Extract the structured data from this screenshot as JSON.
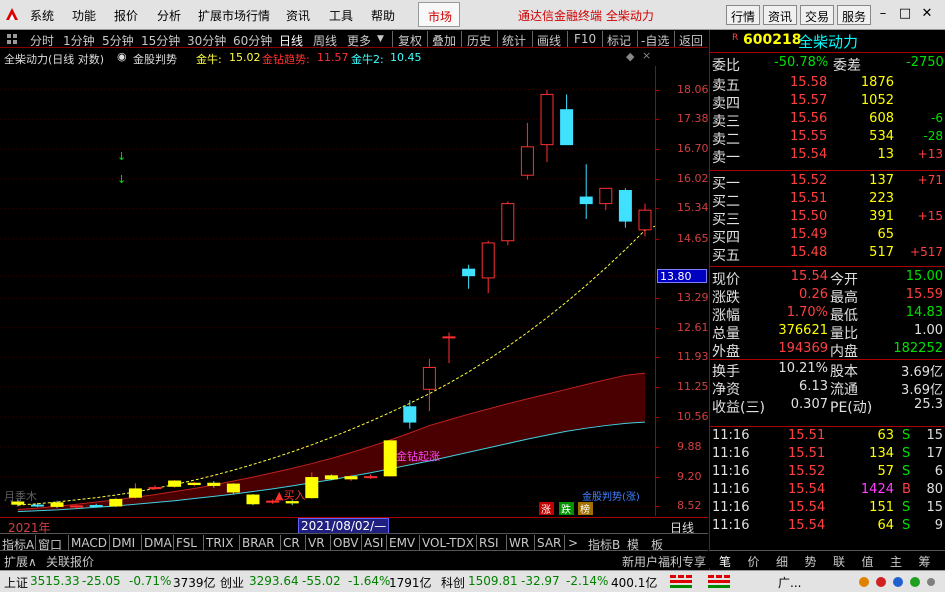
{
  "menu": {
    "items": [
      "系统",
      "功能",
      "报价",
      "分析",
      "扩展市场行情",
      "资讯",
      "工具",
      "帮助"
    ],
    "market": "市场",
    "title": "通达信金融终端 全柴动力",
    "right_buttons": [
      "行情",
      "资讯",
      "交易",
      "服务"
    ]
  },
  "periods": {
    "items": [
      "分时",
      "1分钟",
      "5分钟",
      "15分钟",
      "30分钟",
      "60分钟",
      "日线",
      "周线",
      "更多"
    ],
    "selected": "日线",
    "tools": [
      "复权",
      "叠加",
      "历史",
      "统计",
      "画线",
      "F10",
      "标记",
      "-自选",
      "返回"
    ]
  },
  "chart_info": {
    "stock": "全柴动力(日线 对数)",
    "indicator": "金股判势",
    "jinniu_label": "金牛:",
    "jinniu_val": "15.02",
    "jinzuan_label": "金钻趋势:",
    "jinzuan_val": "11.57",
    "jinniu2_label": "金牛2:",
    "jinniu2_val": "10.45"
  },
  "yaxis": {
    "labels": [
      "18.06",
      "17.38",
      "16.70",
      "16.02",
      "15.34",
      "14.65",
      "13.80",
      "13.29",
      "12.61",
      "11.93",
      "11.25",
      "10.56",
      "9.88",
      "9.20",
      "8.52"
    ],
    "current": "13.80"
  },
  "annotations": {
    "signal1": "金钻起涨",
    "signal2": "买入",
    "watermark": "月季木",
    "legend_box": [
      "涨",
      "跌",
      "榜"
    ],
    "legend_text": "金股判势(涨)"
  },
  "datebar": {
    "left": "2021年",
    "cursor": "2021/08/02/—",
    "right": "日线"
  },
  "tabs": {
    "items": [
      "指标A",
      "窗口",
      "MACD",
      "DMI",
      "DMA",
      "FSL",
      "TRIX",
      "BRAR",
      "CR",
      "VR",
      "OBV",
      "ASI",
      "EMV",
      "VOL-TDX",
      "RSI",
      "WR",
      "SAR"
    ],
    "more": ">",
    "extra": [
      "指标B",
      "模",
      "板"
    ]
  },
  "bottom": {
    "items": [
      "扩展∧",
      "关联报价"
    ],
    "promo": "新用户福利专享"
  },
  "right_panel": {
    "code": "600218",
    "name": "全柴动力",
    "weibi_label": "委比",
    "weibi": "-50.78%",
    "weicha_label": "委差",
    "weicha": "-2750",
    "asks": [
      {
        "label": "卖五",
        "price": "15.58",
        "vol": "1876",
        "chg": ""
      },
      {
        "label": "卖四",
        "price": "15.57",
        "vol": "1052",
        "chg": ""
      },
      {
        "label": "卖三",
        "price": "15.56",
        "vol": "608",
        "chg": "-6"
      },
      {
        "label": "卖二",
        "price": "15.55",
        "vol": "534",
        "chg": "-28"
      },
      {
        "label": "卖一",
        "price": "15.54",
        "vol": "13",
        "chg": "+13"
      }
    ],
    "bids": [
      {
        "label": "买一",
        "price": "15.52",
        "vol": "137",
        "chg": "+71"
      },
      {
        "label": "买二",
        "price": "15.51",
        "vol": "223",
        "chg": ""
      },
      {
        "label": "买三",
        "price": "15.50",
        "vol": "391",
        "chg": "+15"
      },
      {
        "label": "买四",
        "price": "15.49",
        "vol": "65",
        "chg": ""
      },
      {
        "label": "买五",
        "price": "15.48",
        "vol": "517",
        "chg": "+517"
      }
    ],
    "stats": [
      {
        "l1": "现价",
        "v1": "15.54",
        "l2": "今开",
        "v2": "15.00"
      },
      {
        "l1": "涨跌",
        "v1": "0.26",
        "l2": "最高",
        "v2": "15.59"
      },
      {
        "l1": "涨幅",
        "v1": "1.70%",
        "l2": "最低",
        "v2": "14.83"
      },
      {
        "l1": "总量",
        "v1": "376621",
        "l2": "量比",
        "v2": "1.00"
      },
      {
        "l1": "外盘",
        "v1": "194369",
        "l2": "内盘",
        "v2": "182252"
      },
      {
        "l1": "换手",
        "v1": "10.21%",
        "l2": "股本",
        "v2": "3.69亿"
      },
      {
        "l1": "净资",
        "v1": "6.13",
        "l2": "流通",
        "v2": "3.69亿"
      },
      {
        "l1": "收益(三)",
        "v1": "0.307",
        "l2": "PE(动)",
        "v2": "25.3"
      }
    ],
    "ticks": [
      {
        "t": "11:16",
        "p": "15.51",
        "v": "63",
        "s": "S",
        "n": "15"
      },
      {
        "t": "11:16",
        "p": "15.51",
        "v": "134",
        "s": "S",
        "n": "17"
      },
      {
        "t": "11:16",
        "p": "15.52",
        "v": "57",
        "s": "S",
        "n": "6"
      },
      {
        "t": "11:16",
        "p": "15.54",
        "v": "1424",
        "s": "B",
        "n": "80"
      },
      {
        "t": "11:16",
        "p": "15.54",
        "v": "151",
        "s": "S",
        "n": "15"
      },
      {
        "t": "11:16",
        "p": "15.54",
        "v": "64",
        "s": "S",
        "n": "9"
      }
    ],
    "tabs": [
      "笔",
      "价",
      "细",
      "势",
      "联",
      "值",
      "主",
      "筹"
    ]
  },
  "status": {
    "items": [
      {
        "name": "上证",
        "val": "3515.33",
        "chg": "-25.05",
        "pct": "-0.71%",
        "amt": "3739亿"
      },
      {
        "name": "创业",
        "val": "3293.64",
        "chg": "-55.02",
        "pct": "-1.64%",
        "amt": "1791亿"
      },
      {
        "name": "科创",
        "val": "1509.81",
        "chg": "-32.97",
        "pct": "-2.14%",
        "amt": "400.1亿"
      }
    ],
    "right": "广..."
  },
  "chart_data": {
    "type": "candlestick",
    "candles": [
      {
        "o": 8.62,
        "h": 8.68,
        "l": 8.52,
        "c": 8.57
      },
      {
        "o": 8.55,
        "h": 8.6,
        "l": 8.5,
        "c": 8.53
      },
      {
        "o": 8.6,
        "h": 8.65,
        "l": 8.48,
        "c": 8.52
      },
      {
        "o": 8.51,
        "h": 8.55,
        "l": 8.47,
        "c": 8.53
      },
      {
        "o": 8.54,
        "h": 8.58,
        "l": 8.5,
        "c": 8.52
      },
      {
        "o": 8.53,
        "h": 8.72,
        "l": 8.5,
        "c": 8.68
      },
      {
        "o": 8.73,
        "h": 9.05,
        "l": 8.7,
        "c": 8.92
      },
      {
        "o": 8.95,
        "h": 9.0,
        "l": 8.9,
        "c": 8.95
      },
      {
        "o": 8.98,
        "h": 9.12,
        "l": 8.95,
        "c": 9.1
      },
      {
        "o": 9.02,
        "h": 9.08,
        "l": 8.98,
        "c": 9.05
      },
      {
        "o": 9.05,
        "h": 9.1,
        "l": 8.95,
        "c": 9.0
      },
      {
        "o": 9.03,
        "h": 9.05,
        "l": 8.8,
        "c": 8.85
      },
      {
        "o": 8.78,
        "h": 8.8,
        "l": 8.55,
        "c": 8.58
      },
      {
        "o": 8.62,
        "h": 8.68,
        "l": 8.58,
        "c": 8.64
      },
      {
        "o": 8.63,
        "h": 8.66,
        "l": 8.55,
        "c": 8.6
      },
      {
        "o": 8.72,
        "h": 9.3,
        "l": 8.7,
        "c": 9.18
      },
      {
        "o": 9.22,
        "h": 9.25,
        "l": 9.12,
        "c": 9.15
      },
      {
        "o": 9.15,
        "h": 9.24,
        "l": 9.1,
        "c": 9.2
      },
      {
        "o": 9.18,
        "h": 9.25,
        "l": 9.15,
        "c": 9.2
      },
      {
        "o": 9.22,
        "h": 10.05,
        "l": 9.2,
        "c": 10.02
      },
      {
        "o": 10.8,
        "h": 10.95,
        "l": 10.3,
        "c": 10.45
      },
      {
        "o": 11.2,
        "h": 11.9,
        "l": 10.7,
        "c": 11.7
      },
      {
        "o": 12.4,
        "h": 12.5,
        "l": 11.8,
        "c": 12.4
      },
      {
        "o": 13.95,
        "h": 14.05,
        "l": 13.5,
        "c": 13.8
      },
      {
        "o": 13.75,
        "h": 14.6,
        "l": 13.4,
        "c": 14.55
      },
      {
        "o": 14.6,
        "h": 15.5,
        "l": 14.5,
        "c": 15.45
      },
      {
        "o": 16.1,
        "h": 17.3,
        "l": 16.0,
        "c": 16.75
      },
      {
        "o": 16.8,
        "h": 18.05,
        "l": 16.4,
        "c": 17.95
      },
      {
        "o": 17.6,
        "h": 17.95,
        "l": 16.8,
        "c": 16.8
      },
      {
        "o": 15.6,
        "h": 16.35,
        "l": 15.1,
        "c": 15.45
      },
      {
        "o": 15.45,
        "h": 15.8,
        "l": 15.3,
        "c": 15.8
      },
      {
        "o": 15.75,
        "h": 15.8,
        "l": 14.9,
        "c": 15.05
      },
      {
        "o": 14.85,
        "h": 15.45,
        "l": 14.7,
        "c": 15.3
      }
    ],
    "ylim": [
      8.3,
      18.6
    ],
    "yticks": [
      18.06,
      17.38,
      16.7,
      16.02,
      15.34,
      14.65,
      13.8,
      13.29,
      12.61,
      11.93,
      11.25,
      10.56,
      9.88,
      9.2,
      8.52
    ],
    "jinniu": [
      8.55,
      8.58,
      8.62,
      8.67,
      8.72,
      8.78,
      8.85,
      8.93,
      9.02,
      9.12,
      9.23,
      9.35,
      9.48,
      9.62,
      9.77,
      9.93,
      10.1,
      10.28,
      10.47,
      10.67,
      10.88,
      11.1,
      11.34,
      11.6,
      11.88,
      12.18,
      12.5,
      12.84,
      13.2,
      13.58,
      13.98,
      14.4,
      14.84,
      15.02
    ],
    "band_upper": [
      8.45,
      8.48,
      8.52,
      8.57,
      8.62,
      8.67,
      8.73,
      8.79,
      8.86,
      8.93,
      9.01,
      9.1,
      9.19,
      9.29,
      9.39,
      9.5,
      9.62,
      9.75,
      9.89,
      10.04,
      10.2,
      10.37,
      10.5,
      10.63,
      10.75,
      10.87,
      10.98,
      11.09,
      11.2,
      11.31,
      11.42,
      11.52,
      11.57
    ],
    "band_lower": [
      8.4,
      8.42,
      8.44,
      8.47,
      8.5,
      8.53,
      8.57,
      8.61,
      8.65,
      8.7,
      8.75,
      8.8,
      8.86,
      8.92,
      8.99,
      9.06,
      9.13,
      9.21,
      9.29,
      9.38,
      9.47,
      9.56,
      9.66,
      9.76,
      9.86,
      9.96,
      10.06,
      10.15,
      10.24,
      10.31,
      10.37,
      10.42,
      10.45
    ]
  }
}
